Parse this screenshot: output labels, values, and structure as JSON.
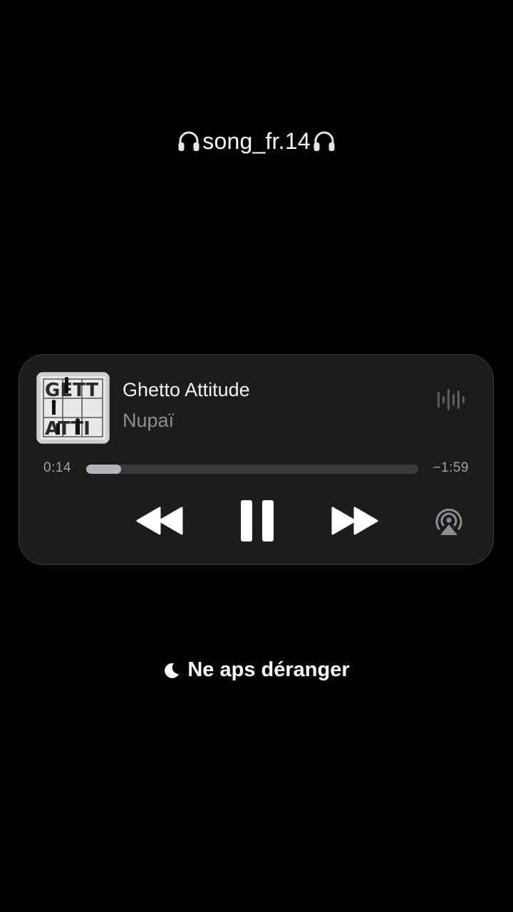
{
  "caption": {
    "text": "song_fr.14",
    "leading_icon": "headphones-icon",
    "trailing_icon": "headphones-icon"
  },
  "player": {
    "track_title": "Ghetto Attitude",
    "artist": "Nupaï",
    "album_art_icon": "album-cover",
    "elapsed": "0:14",
    "remaining": "−1:59",
    "progress_fraction": 0.105,
    "controls": {
      "rewind_icon": "rewind-icon",
      "pause_icon": "pause-icon",
      "forward_icon": "fast-forward-icon",
      "airplay_icon": "airplay-audio-icon",
      "waveform_icon": "waveform-icon"
    }
  },
  "status": {
    "dnd_icon": "moon-icon",
    "dnd_text": "Ne aps déranger"
  },
  "colors": {
    "background": "#000000",
    "card_background": "#1c1c1e",
    "card_border": "#3a3a3c",
    "progress_fill": "#b3b3b8",
    "progress_track": "#3a3a3c",
    "secondary_text": "#8e8e93"
  }
}
